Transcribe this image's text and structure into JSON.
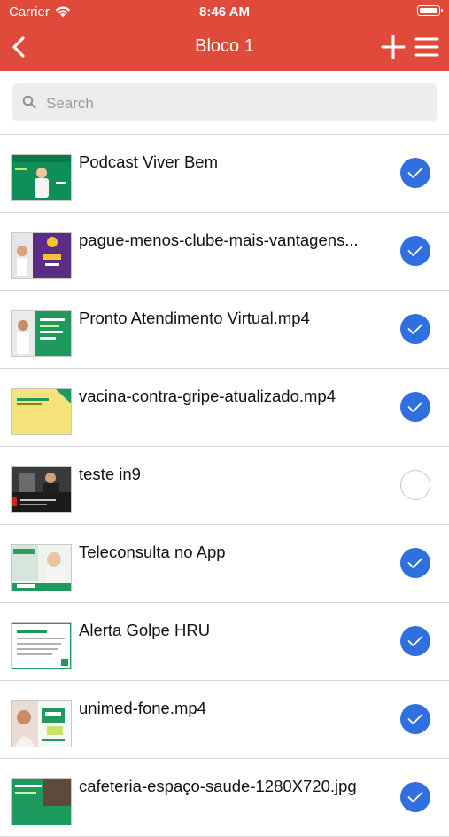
{
  "status_bar": {
    "carrier": "Carrier",
    "time": "8:46 AM"
  },
  "navbar": {
    "title": "Bloco 1",
    "back_icon": "chevron-left-icon",
    "add_icon": "plus-icon",
    "menu_icon": "hamburger-menu-icon"
  },
  "search": {
    "placeholder": "Search",
    "value": ""
  },
  "colors": {
    "header": "#e04a3a",
    "check": "#2f6fe0"
  },
  "items": [
    {
      "title": "Podcast Viver Bem",
      "checked": true
    },
    {
      "title": "pague-menos-clube-mais-vantagens...",
      "checked": true
    },
    {
      "title": "Pronto Atendimento Virtual.mp4",
      "checked": true
    },
    {
      "title": "vacina-contra-gripe-atualizado.mp4",
      "checked": true
    },
    {
      "title": "teste in9",
      "checked": false
    },
    {
      "title": "Teleconsulta no App",
      "checked": true
    },
    {
      "title": "Alerta Golpe HRU",
      "checked": true
    },
    {
      "title": "unimed-fone.mp4",
      "checked": true
    },
    {
      "title": "cafeteria-espaço-saude-1280X720.jpg",
      "checked": true
    }
  ]
}
